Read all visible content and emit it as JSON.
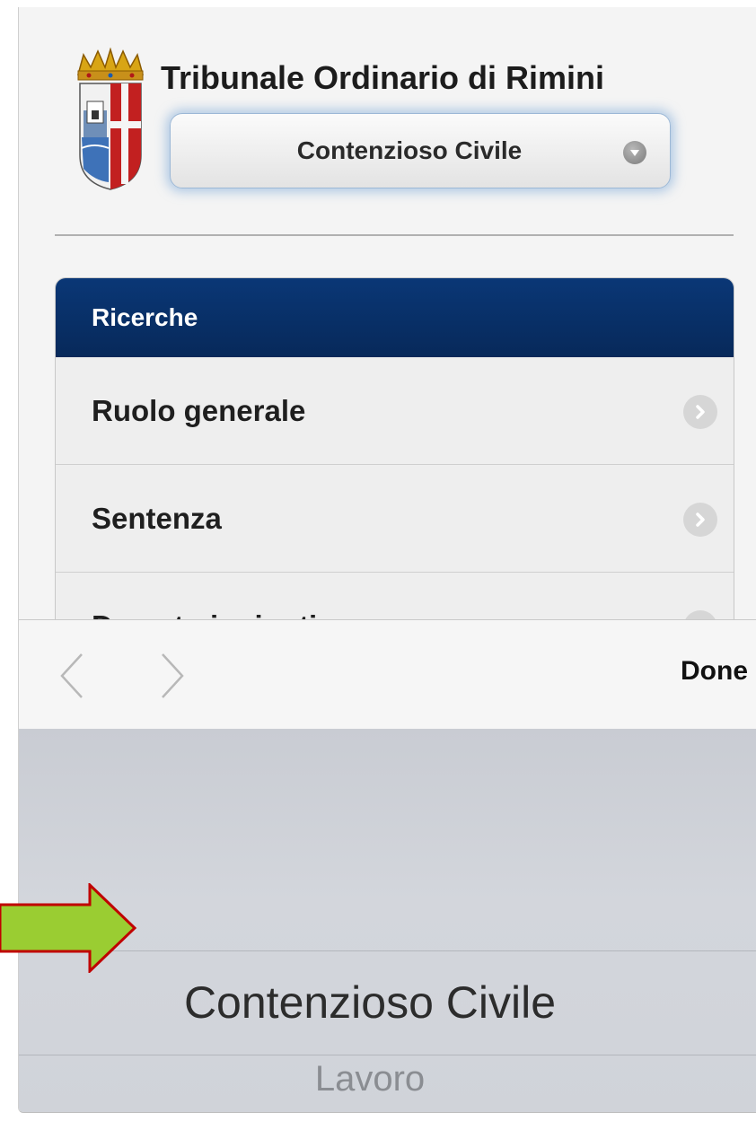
{
  "header": {
    "court_title": "Tribunale Ordinario di Rimini",
    "section_select": {
      "selected_value": "Contenzioso Civile"
    }
  },
  "list": {
    "header": "Ricerche",
    "items": [
      {
        "label": "Ruolo generale"
      },
      {
        "label": "Sentenza"
      },
      {
        "label": "Decreto ingiuntivo"
      }
    ]
  },
  "accessory_bar": {
    "prev_icon": "chevron-left-icon",
    "next_icon": "chevron-right-icon",
    "done_label": "Done"
  },
  "picker": {
    "options": [
      "Contenzioso Civile",
      "Lavoro"
    ],
    "selected": "Contenzioso Civile",
    "next": "Lavoro"
  },
  "colors": {
    "list_header_bg": "#0a3776",
    "select_glow": "#78a5d7",
    "annotation_arrow_fill": "#9acd32",
    "annotation_arrow_stroke": "#c00000"
  }
}
